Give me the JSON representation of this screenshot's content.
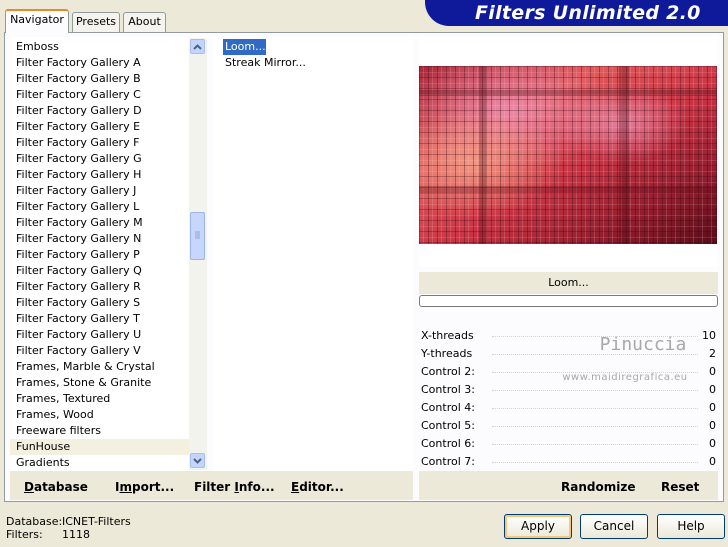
{
  "tabs": [
    {
      "label": "Navigator"
    },
    {
      "label": "Presets"
    },
    {
      "label": "About"
    }
  ],
  "banner_title": "Filters Unlimited 2.0",
  "categories": [
    "Emboss",
    "Filter Factory Gallery A",
    "Filter Factory Gallery B",
    "Filter Factory Gallery C",
    "Filter Factory Gallery D",
    "Filter Factory Gallery E",
    "Filter Factory Gallery F",
    "Filter Factory Gallery G",
    "Filter Factory Gallery H",
    "Filter Factory Gallery J",
    "Filter Factory Gallery L",
    "Filter Factory Gallery M",
    "Filter Factory Gallery N",
    "Filter Factory Gallery P",
    "Filter Factory Gallery Q",
    "Filter Factory Gallery R",
    "Filter Factory Gallery S",
    "Filter Factory Gallery T",
    "Filter Factory Gallery U",
    "Filter Factory Gallery V",
    "Frames, Marble & Crystal",
    "Frames, Stone & Granite",
    "Frames, Textured",
    "Frames, Wood",
    "Freeware filters",
    "FunHouse",
    "Gradients"
  ],
  "selected_category": "FunHouse",
  "filters": [
    "Loom...",
    "Streak Mirror..."
  ],
  "selected_filter": "Loom...",
  "preview_filter_name": "Loom...",
  "controls": [
    {
      "label": "X-threads",
      "value": "10"
    },
    {
      "label": "Y-threads",
      "value": "2"
    },
    {
      "label": "Control 2:",
      "value": "0"
    },
    {
      "label": "Control 3:",
      "value": "0"
    },
    {
      "label": "Control 4:",
      "value": "0"
    },
    {
      "label": "Control 5:",
      "value": "0"
    },
    {
      "label": "Control 6:",
      "value": "0"
    },
    {
      "label": "Control 7:",
      "value": "0"
    }
  ],
  "watermark": {
    "name": "Pinuccia",
    "site": "www.maidiregrafica.eu"
  },
  "toolbar": {
    "database": "Database",
    "import": "Import...",
    "filter_info": "Filter Info...",
    "editor": "Editor...",
    "randomize": "Randomize",
    "reset": "Reset"
  },
  "status": {
    "database_label": "Database:",
    "database_value": "ICNET-Filters",
    "filters_label": "Filters:",
    "filters_value": "1118"
  },
  "buttons": {
    "apply": "Apply",
    "cancel": "Cancel",
    "help": "Help"
  },
  "colors": {
    "banner": "#0e1a9a",
    "selection": "#316ac5",
    "active_tab": "#e68b2c"
  }
}
